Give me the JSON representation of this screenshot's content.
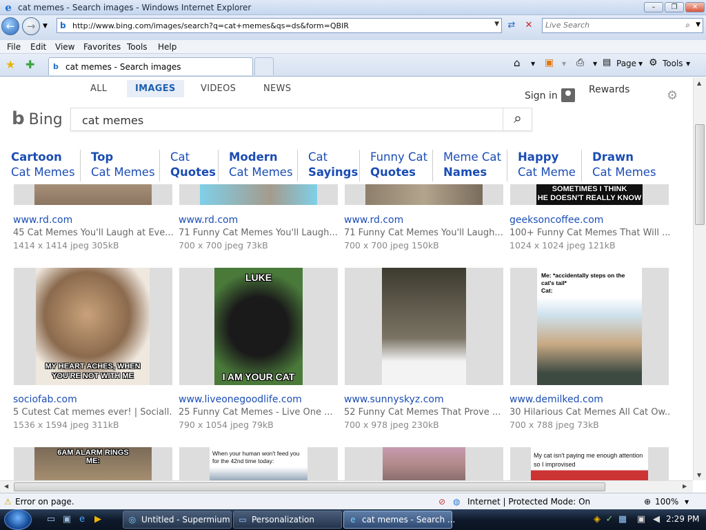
{
  "window": {
    "title": "cat memes - Search images - Windows Internet Explorer",
    "min": "–",
    "max": "❐",
    "close": "✕"
  },
  "address": {
    "url": "http://www.bing.com/images/search?q=cat+memes&qs=ds&form=QBIR",
    "live_search_placeholder": "Live Search"
  },
  "menu": [
    "File",
    "Edit",
    "View",
    "Favorites",
    "Tools",
    "Help"
  ],
  "tab": {
    "title": "cat memes - Search images"
  },
  "toolbar": {
    "page": "Page",
    "tools": "Tools"
  },
  "bing": {
    "logo": "Bing",
    "scopes": [
      "ALL",
      "IMAGES",
      "VIDEOS",
      "NEWS"
    ],
    "signin": "Sign in",
    "rewards": "Rewards",
    "query": "cat memes",
    "pills": [
      {
        "l1": "Cartoon",
        "l2": "Cat Memes",
        "bold": 1
      },
      {
        "l1": "Top",
        "l2": "Cat Memes",
        "bold": 1
      },
      {
        "l1": "Cat",
        "l2": "Quotes",
        "bold": 2
      },
      {
        "l1": "Modern",
        "l2": "Cat Memes",
        "bold": 1
      },
      {
        "l1": "Cat",
        "l2": "Sayings",
        "bold": 2
      },
      {
        "l1": "Funny Cat",
        "l2": "Quotes",
        "bold": 2
      },
      {
        "l1": "Meme Cat",
        "l2": "Names",
        "bold": 2
      },
      {
        "l1": "Happy",
        "l2": "Cat Meme",
        "bold": 1
      },
      {
        "l1": "Drawn",
        "l2": "Cat Memes",
        "bold": 1
      }
    ]
  },
  "results_row1": [
    {
      "site": "www.rd.com",
      "title": "45 Cat Memes You'll Laugh at Eve...",
      "meta": "1414 x 1414 jpeg 305kB"
    },
    {
      "site": "www.rd.com",
      "title": "71 Funny Cat Memes You'll Laugh...",
      "meta": "700 x 700 jpeg 73kB"
    },
    {
      "site": "www.rd.com",
      "title": "71 Funny Cat Memes You'll Laugh...",
      "meta": "700 x 700 jpeg 150kB"
    },
    {
      "site": "geeksoncoffee.com",
      "title": "100+ Funny Cat Memes That Will ...",
      "meta": "1024 x 1024 jpeg 121kB",
      "caption": "SOMETIMES I THINK\nHE DOESN'T REALLY KNOW"
    }
  ],
  "results_row2": [
    {
      "site": "sociofab.com",
      "title": "5 Cutest Cat memes ever! | Sociall...",
      "meta": "1536 x 1594 jpeg 311kB",
      "caption_bottom": "MY HEART ACHES, WHEN YOU'RE NOT WITH ME"
    },
    {
      "site": "www.liveonegoodlife.com",
      "title": "25 Funny Cat Memes - Live One ...",
      "meta": "790 x 1054 jpeg 79kB",
      "caption_top": "LUKE",
      "caption_bottom": "I AM YOUR CAT"
    },
    {
      "site": "www.sunnyskyz.com",
      "title": "52 Funny Cat Memes That Prove ...",
      "meta": "700 x 978 jpeg 230kB"
    },
    {
      "site": "www.demilked.com",
      "title": "30 Hilarious Cat Memes All Cat Ow...",
      "meta": "700 x 788 jpeg 73kB",
      "caption_top": "Me: *accidentally steps on the cat's tail*\nCat:"
    }
  ],
  "results_row3": [
    {
      "caption": "6AM ALARM RINGS\nME:"
    },
    {
      "caption": "When your human won't feed you for the 42nd time today:"
    },
    {
      "caption": ""
    },
    {
      "caption": "My cat isn't paying me enough attention so I improvised"
    }
  ],
  "status": {
    "text": "Error on page.",
    "zone": "Internet | Protected Mode: On",
    "zoom": "100%"
  },
  "taskbar": {
    "tasks": [
      "Untitled - Supermium",
      "Personalization",
      "cat memes - Search ..."
    ],
    "clock": "2:29 PM"
  },
  "colors": {
    "link": "#1b4db4",
    "scope_active": "#1d5fb0",
    "taskbar": "#0f1a2b"
  }
}
